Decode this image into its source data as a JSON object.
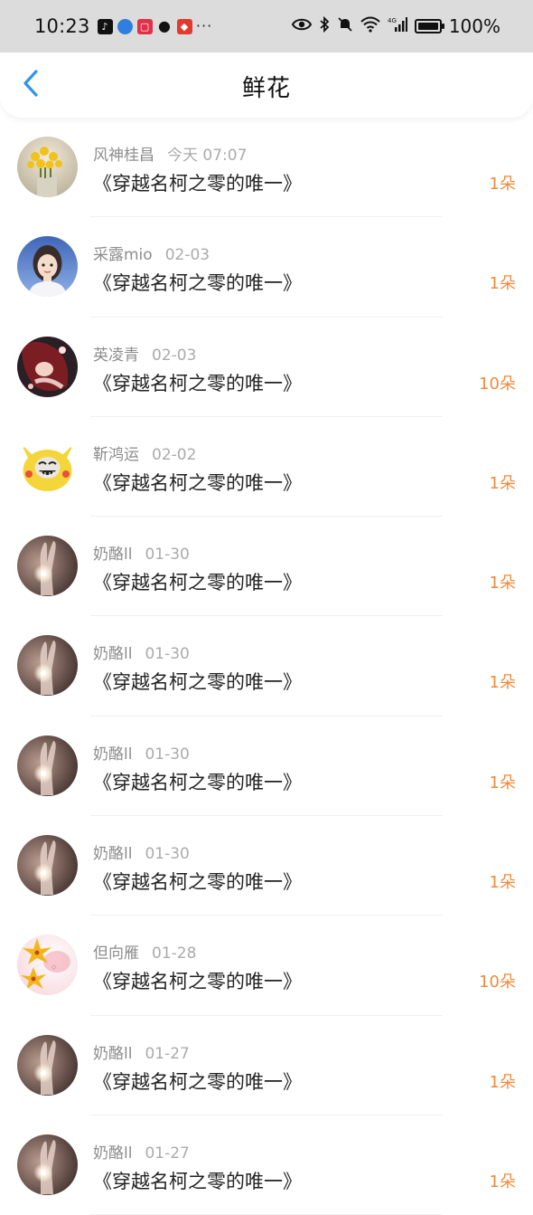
{
  "status_bar": {
    "time": "10:23",
    "battery_text": "100%",
    "battery_level": 1.0,
    "network_label": "4G",
    "left_icons": [
      "tiktok-icon",
      "globe-icon",
      "app-icon",
      "chat-icon",
      "red-app-icon",
      "more-icon"
    ],
    "right_icons": [
      "eye-icon",
      "bluetooth-icon",
      "mute-icon",
      "wifi-icon",
      "signal-icon",
      "battery-icon"
    ]
  },
  "header": {
    "title": "鲜花",
    "back_icon": "chevron-left-icon",
    "accent_color": "#2f95e9"
  },
  "colors": {
    "flower_count": "#f08a3c",
    "username": "#8d8d8d",
    "timestamp": "#ababab",
    "title": "#222222"
  },
  "list": {
    "items": [
      {
        "user": "风神桂昌",
        "time": "今天 07:07",
        "title": "《穿越名柯之零的唯一》",
        "count": "1朵",
        "avatar": "flowers"
      },
      {
        "user": "采露mio",
        "time": "02-03",
        "title": "《穿越名柯之零的唯一》",
        "count": "1朵",
        "avatar": "girl"
      },
      {
        "user": "英凌青",
        "time": "02-03",
        "title": "《穿越名柯之零的唯一》",
        "count": "10朵",
        "avatar": "anime"
      },
      {
        "user": "靳鸿运",
        "time": "02-02",
        "title": "《穿越名柯之零的唯一》",
        "count": "1朵",
        "avatar": "pikachu"
      },
      {
        "user": "奶酪ll",
        "time": "01-30",
        "title": "《穿越名柯之零的唯一》",
        "count": "1朵",
        "avatar": "hand"
      },
      {
        "user": "奶酪ll",
        "time": "01-30",
        "title": "《穿越名柯之零的唯一》",
        "count": "1朵",
        "avatar": "hand"
      },
      {
        "user": "奶酪ll",
        "time": "01-30",
        "title": "《穿越名柯之零的唯一》",
        "count": "1朵",
        "avatar": "hand"
      },
      {
        "user": "奶酪ll",
        "time": "01-30",
        "title": "《穿越名柯之零的唯一》",
        "count": "1朵",
        "avatar": "hand"
      },
      {
        "user": "但向雁",
        "time": "01-28",
        "title": "《穿越名柯之零的唯一》",
        "count": "10朵",
        "avatar": "lily"
      },
      {
        "user": "奶酪ll",
        "time": "01-27",
        "title": "《穿越名柯之零的唯一》",
        "count": "1朵",
        "avatar": "hand"
      },
      {
        "user": "奶酪ll",
        "time": "01-27",
        "title": "《穿越名柯之零的唯一》",
        "count": "1朵",
        "avatar": "hand"
      }
    ]
  }
}
